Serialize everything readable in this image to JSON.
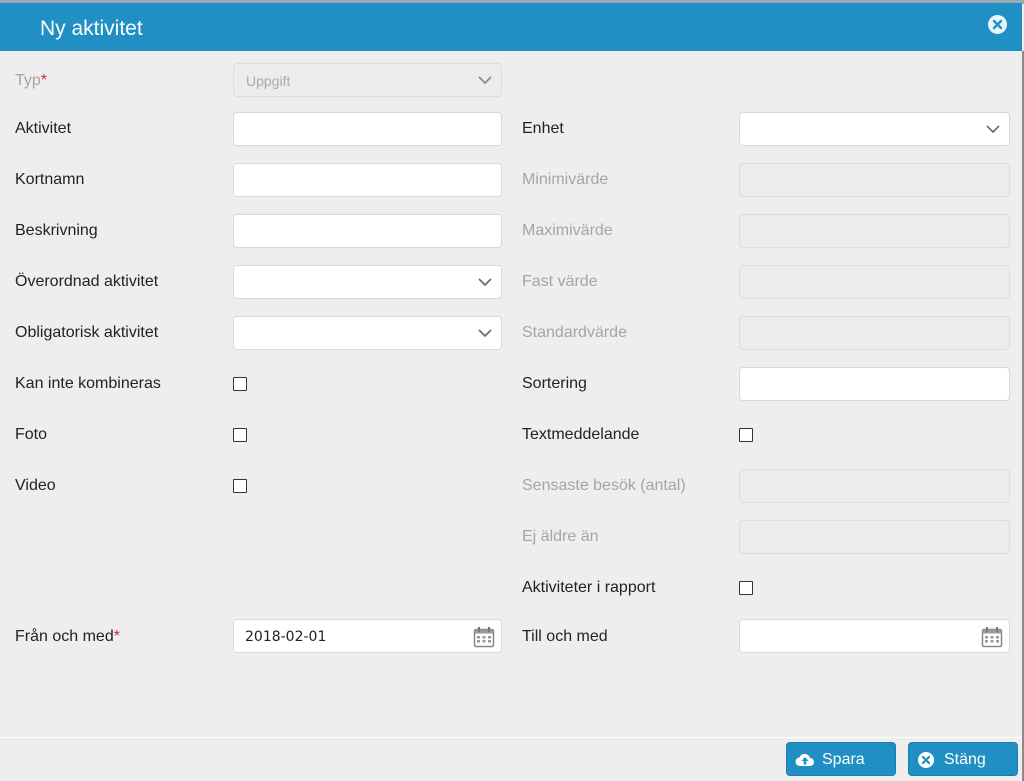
{
  "dialog": {
    "title": "Ny aktivitet"
  },
  "left": {
    "typ": {
      "label": "Typ",
      "required": "*",
      "value": "Uppgift"
    },
    "aktivitet": {
      "label": "Aktivitet",
      "value": ""
    },
    "kortnamn": {
      "label": "Kortnamn",
      "value": ""
    },
    "beskrivning": {
      "label": "Beskrivning",
      "value": ""
    },
    "overordnad": {
      "label": "Överordnad aktivitet",
      "value": ""
    },
    "obligatorisk": {
      "label": "Obligatorisk aktivitet",
      "value": ""
    },
    "kan_inte": {
      "label": "Kan inte kombineras"
    },
    "foto": {
      "label": "Foto"
    },
    "video": {
      "label": "Video"
    },
    "fran": {
      "label": "Från och med",
      "required": "*",
      "value": "2018-02-01"
    }
  },
  "right": {
    "enhet": {
      "label": "Enhet",
      "value": ""
    },
    "minimivarde": {
      "label": "Minimivärde"
    },
    "maximivarde": {
      "label": "Maximivärde"
    },
    "fast_varde": {
      "label": "Fast värde"
    },
    "standardvarde": {
      "label": "Standardvärde"
    },
    "sortering": {
      "label": "Sortering",
      "value": ""
    },
    "textmeddelande": {
      "label": "Textmeddelande"
    },
    "sensaste": {
      "label": "Sensaste besök (antal)"
    },
    "ej_aldre": {
      "label": "Ej äldre än"
    },
    "aktiviteter_rapport": {
      "label": "Aktiviteter i rapport"
    },
    "till": {
      "label": "Till och med",
      "value": ""
    }
  },
  "footer": {
    "save_label": "Spara",
    "close_label": "Stäng"
  },
  "icons": {
    "close": "close-circle-icon",
    "chevron": "chevron-down-icon",
    "calendar": "calendar-icon",
    "upload": "cloud-upload-icon"
  },
  "colors": {
    "accent": "#1f8fc4",
    "required": "#d9232e"
  }
}
